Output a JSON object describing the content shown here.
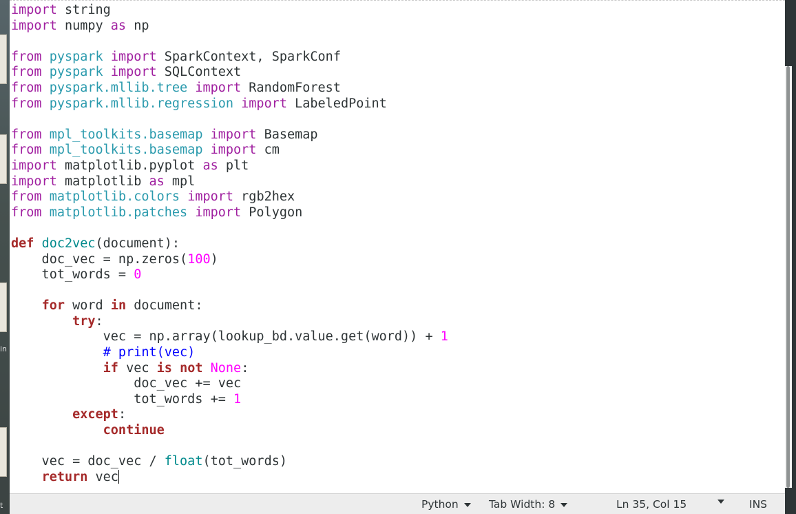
{
  "desktop": {
    "icon_label_1": "in",
    "icon_label_2": "t"
  },
  "code": {
    "lines": [
      [
        {
          "t": "import",
          "c": "kw"
        },
        {
          "t": " string"
        }
      ],
      [
        {
          "t": "import",
          "c": "kw"
        },
        {
          "t": " numpy "
        },
        {
          "t": "as",
          "c": "kw"
        },
        {
          "t": " np"
        }
      ],
      [],
      [
        {
          "t": "from",
          "c": "kw"
        },
        {
          "t": " "
        },
        {
          "t": "pyspark",
          "c": "mod"
        },
        {
          "t": " "
        },
        {
          "t": "import",
          "c": "kw"
        },
        {
          "t": " SparkContext, SparkConf"
        }
      ],
      [
        {
          "t": "from",
          "c": "kw"
        },
        {
          "t": " "
        },
        {
          "t": "pyspark",
          "c": "mod"
        },
        {
          "t": " "
        },
        {
          "t": "import",
          "c": "kw"
        },
        {
          "t": " SQLContext"
        }
      ],
      [
        {
          "t": "from",
          "c": "kw"
        },
        {
          "t": " "
        },
        {
          "t": "pyspark.mllib.tree",
          "c": "mod"
        },
        {
          "t": " "
        },
        {
          "t": "import",
          "c": "kw"
        },
        {
          "t": " RandomForest"
        }
      ],
      [
        {
          "t": "from",
          "c": "kw"
        },
        {
          "t": " "
        },
        {
          "t": "pyspark.mllib.regression",
          "c": "mod"
        },
        {
          "t": " "
        },
        {
          "t": "import",
          "c": "kw"
        },
        {
          "t": " LabeledPoint"
        }
      ],
      [],
      [
        {
          "t": "from",
          "c": "kw"
        },
        {
          "t": " "
        },
        {
          "t": "mpl_toolkits.basemap",
          "c": "mod"
        },
        {
          "t": " "
        },
        {
          "t": "import",
          "c": "kw"
        },
        {
          "t": " Basemap"
        }
      ],
      [
        {
          "t": "from",
          "c": "kw"
        },
        {
          "t": " "
        },
        {
          "t": "mpl_toolkits.basemap",
          "c": "mod"
        },
        {
          "t": " "
        },
        {
          "t": "import",
          "c": "kw"
        },
        {
          "t": " cm"
        }
      ],
      [
        {
          "t": "import",
          "c": "kw"
        },
        {
          "t": " matplotlib.pyplot "
        },
        {
          "t": "as",
          "c": "kw"
        },
        {
          "t": " plt"
        }
      ],
      [
        {
          "t": "import",
          "c": "kw"
        },
        {
          "t": " matplotlib "
        },
        {
          "t": "as",
          "c": "kw"
        },
        {
          "t": " mpl"
        }
      ],
      [
        {
          "t": "from",
          "c": "kw"
        },
        {
          "t": " "
        },
        {
          "t": "matplotlib.colors",
          "c": "mod"
        },
        {
          "t": " "
        },
        {
          "t": "import",
          "c": "kw"
        },
        {
          "t": " rgb2hex"
        }
      ],
      [
        {
          "t": "from",
          "c": "kw"
        },
        {
          "t": " "
        },
        {
          "t": "matplotlib.patches",
          "c": "mod"
        },
        {
          "t": " "
        },
        {
          "t": "import",
          "c": "kw"
        },
        {
          "t": " Polygon"
        }
      ],
      [],
      [
        {
          "t": "def",
          "c": "kwb"
        },
        {
          "t": " "
        },
        {
          "t": "doc2vec",
          "c": "fn"
        },
        {
          "t": "(document):"
        }
      ],
      [
        {
          "t": "    doc_vec = np.zeros("
        },
        {
          "t": "100",
          "c": "num"
        },
        {
          "t": ")"
        }
      ],
      [
        {
          "t": "    tot_words = "
        },
        {
          "t": "0",
          "c": "num"
        }
      ],
      [],
      [
        {
          "t": "    "
        },
        {
          "t": "for",
          "c": "kwb"
        },
        {
          "t": " word "
        },
        {
          "t": "in",
          "c": "kwb"
        },
        {
          "t": " document:"
        }
      ],
      [
        {
          "t": "        "
        },
        {
          "t": "try",
          "c": "kwb"
        },
        {
          "t": ":"
        }
      ],
      [
        {
          "t": "            vec = np.array(lookup_bd.value.get(word)) + "
        },
        {
          "t": "1",
          "c": "num"
        }
      ],
      [
        {
          "t": "            "
        },
        {
          "t": "# print(vec)",
          "c": "com"
        }
      ],
      [
        {
          "t": "            "
        },
        {
          "t": "if",
          "c": "kwb"
        },
        {
          "t": " vec "
        },
        {
          "t": "is",
          "c": "kwb"
        },
        {
          "t": " "
        },
        {
          "t": "not",
          "c": "kwb"
        },
        {
          "t": " "
        },
        {
          "t": "None",
          "c": "num"
        },
        {
          "t": ":"
        }
      ],
      [
        {
          "t": "                doc_vec += vec"
        }
      ],
      [
        {
          "t": "                tot_words += "
        },
        {
          "t": "1",
          "c": "num"
        }
      ],
      [
        {
          "t": "        "
        },
        {
          "t": "except",
          "c": "kwb"
        },
        {
          "t": ":"
        }
      ],
      [
        {
          "t": "            "
        },
        {
          "t": "continue",
          "c": "kwb"
        }
      ],
      [],
      [
        {
          "t": "    vec = doc_vec / "
        },
        {
          "t": "float",
          "c": "fn"
        },
        {
          "t": "(tot_words)"
        }
      ],
      [
        {
          "t": "    "
        },
        {
          "t": "return",
          "c": "kwb"
        },
        {
          "t": " vec"
        }
      ]
    ]
  },
  "statusbar": {
    "language": "Python",
    "tab_width": "Tab Width: 8",
    "position": "Ln 35, Col 15",
    "mode": "INS"
  }
}
